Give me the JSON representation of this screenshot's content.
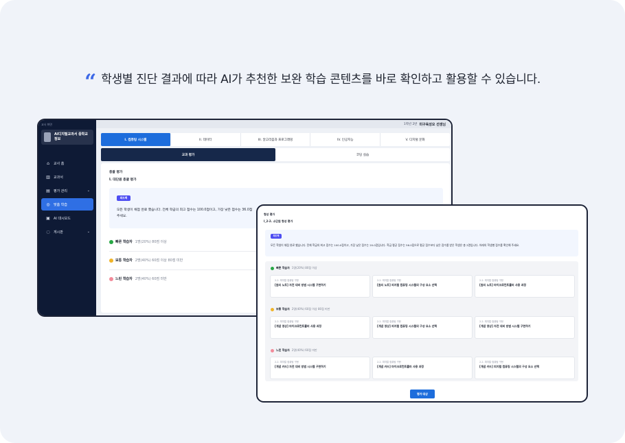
{
  "headline": "학생별 진단 결과에 따라 AI가 추천한 보완 학습 콘텐츠를 바로 확인하고 활용할 수 있습니다.",
  "quote_glyph": "“",
  "colors": {
    "accent": "#1d6ddc",
    "sidebar": "#0e1a35",
    "badge": "#4d4df2",
    "fast": "#27a745",
    "mid": "#f0b429",
    "slow": "#f28b9a"
  },
  "sidebar": {
    "top_label": "교사 화면",
    "school": "AI디지털교과서 중학교 정보",
    "items": [
      {
        "label": "교사 홈",
        "icon": "home-icon",
        "glyph": "⌂"
      },
      {
        "label": "교과서",
        "icon": "book-icon",
        "glyph": "▥"
      },
      {
        "label": "평가 관리",
        "icon": "clipboard-icon",
        "glyph": "▤",
        "chevron": "⌄"
      },
      {
        "label": "맞춤 학습",
        "icon": "target-icon",
        "glyph": "◎",
        "active": true
      },
      {
        "label": "AI 대시보드",
        "icon": "dashboard-icon",
        "glyph": "▣"
      },
      {
        "label": "게시판",
        "icon": "chat-icon",
        "glyph": "◌",
        "chevron": "⌄"
      }
    ]
  },
  "topbar": {
    "class_label": "1학년 2반",
    "teacher": "미구육성오 선생님"
  },
  "tabs": [
    "I. 컴퓨팅 시스템",
    "II. 데이터",
    "III. 알고리즘과 프로그래밍",
    "IV. 인공지능",
    "V. 디지털 문화"
  ],
  "subtabs": [
    "교과 평가",
    "코딩 실습"
  ],
  "back_card": {
    "title": "총괄 평가",
    "subtitle": "I. 대단원 총괄 평가",
    "badge": "피드백",
    "notice": "모든 학생이 채점 완료 했습니다. 전체 학급의 최고 점수는 100.0점이고, 가장 낮은 점수는 36.0점",
    "notice_line2": "주세요.",
    "levels": [
      {
        "name": "빠른 학습자",
        "meta": "1명(20%)  80점 이상",
        "icon": "fast-learner-icon"
      },
      {
        "name": "보통 학습자",
        "meta": "2명(40%)  60점 이상 80점 미만",
        "icon": "mid-learner-icon"
      },
      {
        "name": "느린 학습자",
        "meta": "2명(40%)  60점 미만",
        "icon": "slow-learner-icon"
      }
    ]
  },
  "front_card": {
    "title": "형성 평가",
    "subtitle": "I_2-2. 소단원 형성 평가",
    "badge": "피드백",
    "notice": "모든 학생이 채점 완료 했습니다. 전체 학급의 최고 점수는 100.0점이고, 가장 낮은 점수는 20.0점입니다. 학급 평균 점수는 56.0점으로 평균 점수보다 낮은 점수를 받은 학생은 총 2명입니다. 아래의 학생별 점수를 확인해 주세요.",
    "groups": [
      {
        "name": "빠른 학습자",
        "meta": "1명(20%)  80점 이상",
        "items": [
          {
            "k": "2-2. 피지컬 컴퓨팅 구현",
            "v": "[원리 노트] 자전 대비 방범 시스템 구현하기"
          },
          {
            "k": "2-2. 피지컬 컴퓨팅 구현",
            "v": "[원리 노트] 피지컬 컴퓨팅 시스템의 구성 요소 선택"
          },
          {
            "k": "2-2. 피지컬 컴퓨팅 구현",
            "v": "[원리 노트] 마이크로컨트롤러 사용 과정"
          }
        ]
      },
      {
        "name": "보통 학습자",
        "meta": "2명(40%)  60점 이상 80점 미만",
        "items": [
          {
            "k": "2-2. 피지컬 컴퓨팅 구현",
            "v": "[개념 영상] 마이크로컨트롤러 사용 과정"
          },
          {
            "k": "2-2. 피지컬 컴퓨팅 구현",
            "v": "[개념 영상] 피지컬 컴퓨팅 시스템의 구성 요소 선택"
          },
          {
            "k": "2-2. 피지컬 컴퓨팅 구현",
            "v": "[개념 영상] 자전 대비 방범 시스템 구현하기"
          }
        ]
      },
      {
        "name": "느린 학습자",
        "meta": "2명(40%)  60점 미만",
        "items": [
          {
            "k": "2-2. 피지컬 컴퓨팅 구현",
            "v": "[개념 카드] 자전 대비 방범 시스템 구현하기"
          },
          {
            "k": "2-2. 피지컬 컴퓨팅 구현",
            "v": "[개념 카드] 마이크로컨트롤러 사용 과정"
          },
          {
            "k": "2-2. 피지컬 컴퓨팅 구현",
            "v": "[개념 카드] 피지컬 컴퓨팅 시스템의 구성 요소 선택"
          }
        ]
      }
    ],
    "assign_button": "평가 대상"
  }
}
